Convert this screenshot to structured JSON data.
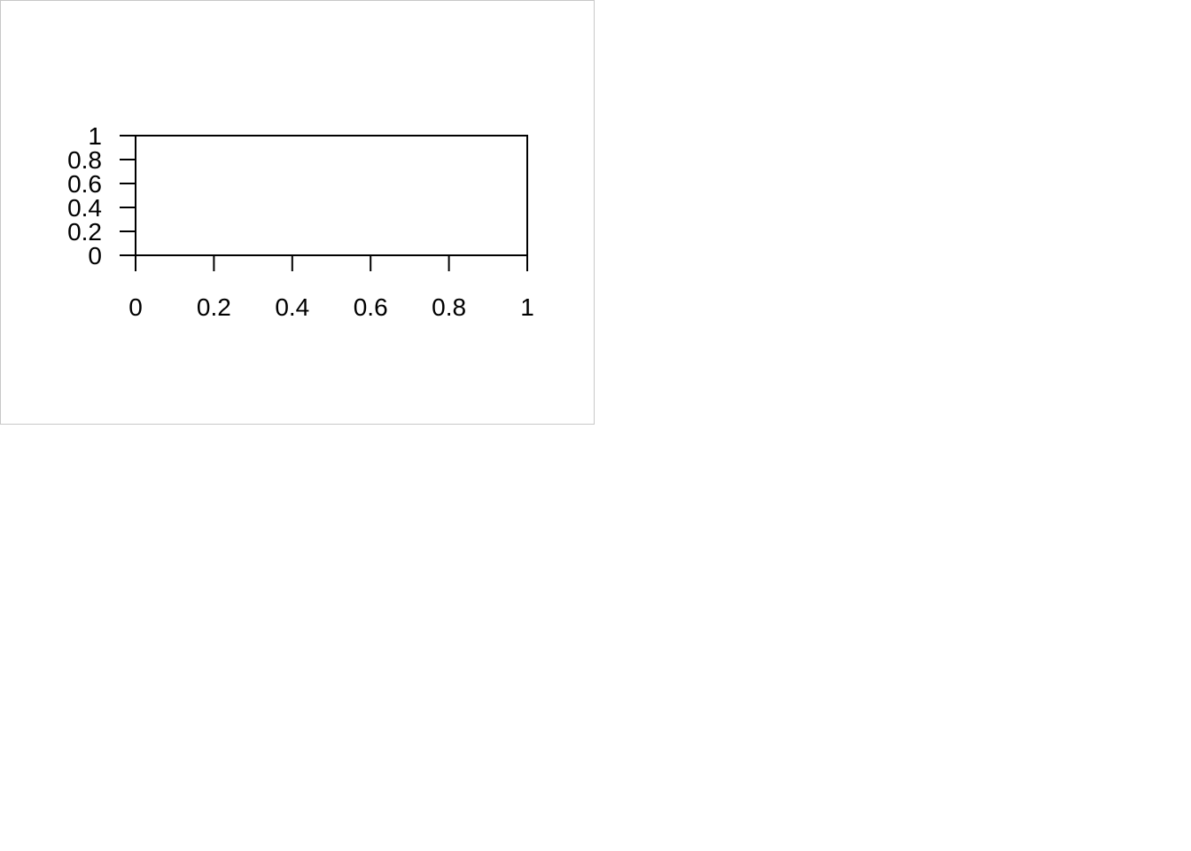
{
  "chart_data": {
    "type": "scatter",
    "title": "",
    "xlabel": "",
    "ylabel": "",
    "xlim": [
      0,
      1
    ],
    "ylim": [
      0,
      1
    ],
    "x_ticks": [
      "0",
      "0.2",
      "0.4",
      "0.6",
      "0.8",
      "1"
    ],
    "y_ticks": [
      "0",
      "0.2",
      "0.4",
      "0.6",
      "0.8",
      "1"
    ],
    "grid": false,
    "series": []
  }
}
